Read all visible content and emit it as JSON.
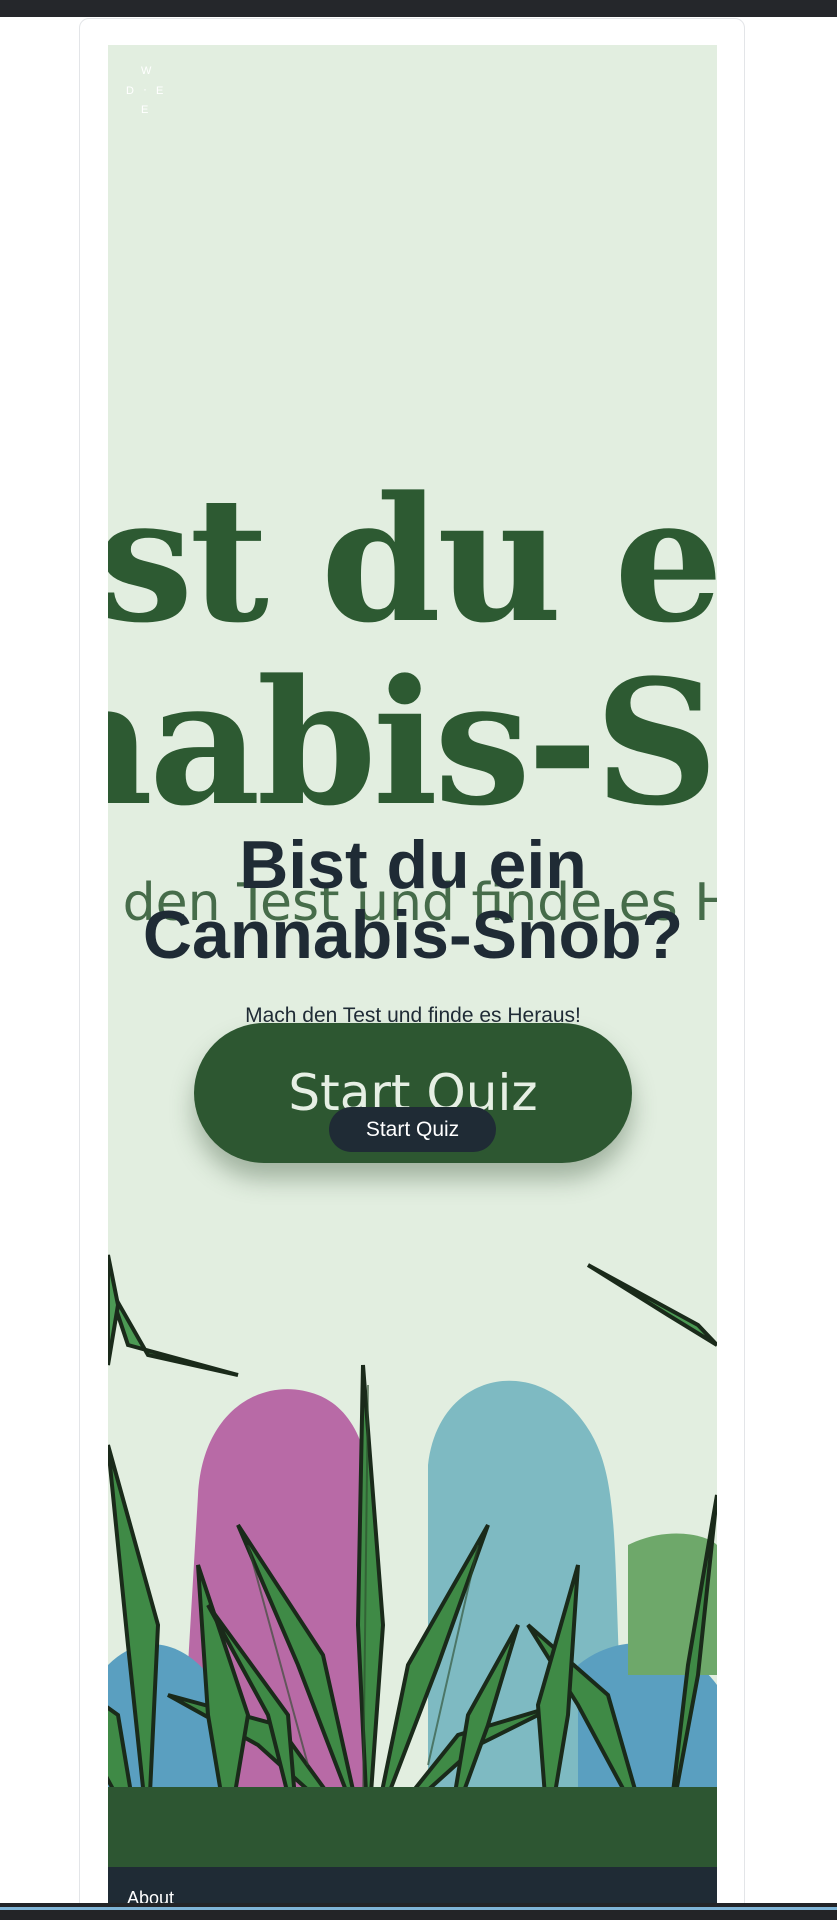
{
  "logo": {
    "letters": [
      "W",
      "D",
      "·",
      "E",
      "E"
    ]
  },
  "hero": {
    "bg_headline_line1": "ist du ei",
    "bg_headline_line2": "nabis-Sn",
    "bg_subline": "den Test und finde es H",
    "bg_button_label": "Start Quiz",
    "title": "Bist du ein Cannabis-Snob?",
    "subtitle": "Mach den Test und finde es Heraus!",
    "cta_label": "Start Quiz"
  },
  "footer": {
    "about_label": "About"
  },
  "colors": {
    "hero_bg": "#e2eee0",
    "brand_green": "#2d5731",
    "navy": "#1f2b35",
    "blob_pink": "#b86aa6",
    "blob_blue": "#7ebac2"
  }
}
